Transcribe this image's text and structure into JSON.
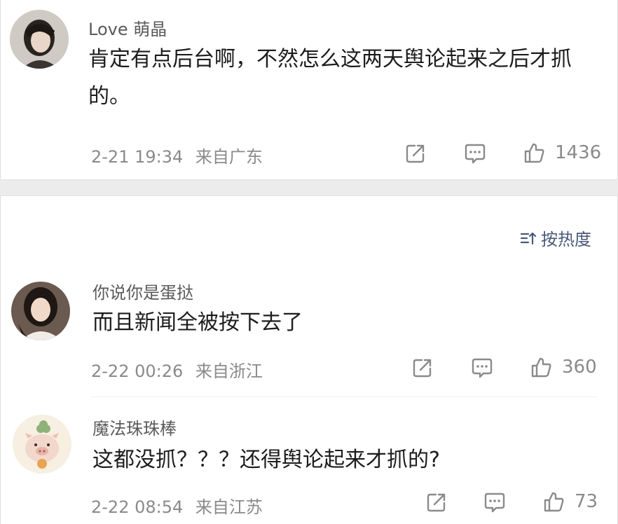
{
  "comments": [
    {
      "username": "Love 萌晶",
      "text": "肯定有点后台啊，不然怎么这两天舆论起来之后才抓的。",
      "time": "2-21 19:34",
      "location": "来自广东",
      "likes": "1436"
    },
    {
      "username": "你说你是蛋挞",
      "text": "而且新闻全被按下去了",
      "time": "2-22 00:26",
      "location": "来自浙江",
      "likes": "360"
    },
    {
      "username": "魔法珠珠棒",
      "text": "这都没抓？？？还得舆论起来才抓的?",
      "time": "2-22 08:54",
      "location": "来自江苏",
      "likes": "73"
    }
  ],
  "sort": {
    "label": "按热度",
    "icon": "sort-icon"
  },
  "icons": {
    "share": "share-icon",
    "comment": "comment-icon",
    "like": "thumbs-up-icon"
  },
  "colors": {
    "text": "#1c1c1c",
    "username": "#5a5a5a",
    "meta": "#8a8a8a",
    "sort": "#4a5a78",
    "band": "#ececec"
  }
}
